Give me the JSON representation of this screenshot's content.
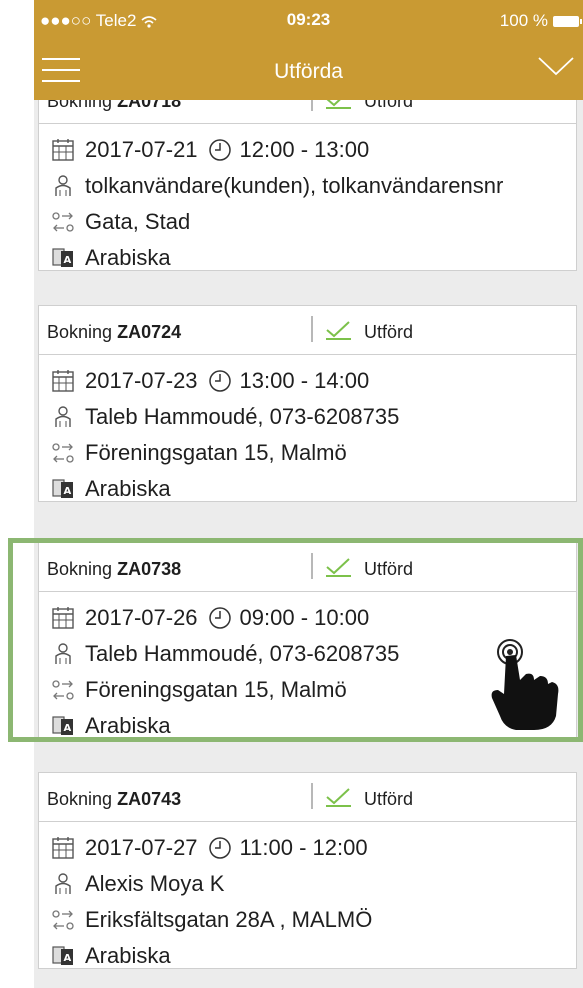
{
  "status_bar": {
    "carrier": "●●●○○ Tele2",
    "wifi_icon": "wifi-icon",
    "time": "09:23",
    "battery": "100 %"
  },
  "nav": {
    "menu_icon": "hamburger-menu-icon",
    "title": "Utförda",
    "dropdown_icon": "chevron-down-icon"
  },
  "accent_color": "#c99a33",
  "highlight_color": "#8cb772",
  "bookings": [
    {
      "prefix": "Bokning",
      "id": "ZA0718",
      "status": "Utförd",
      "date": "2017-07-21",
      "time": "12:00 - 13:00",
      "customer": "tolkanvändare(kunden), tolkanvändarensnr",
      "address": "Gata, Stad",
      "language": "Arabiska"
    },
    {
      "prefix": "Bokning",
      "id": "ZA0724",
      "status": "Utförd",
      "date": "2017-07-23",
      "time": "13:00 - 14:00",
      "customer": "Taleb Hammoudé, 073-6208735",
      "address": "Föreningsgatan 15, Malmö",
      "language": "Arabiska"
    },
    {
      "prefix": "Bokning",
      "id": "ZA0738",
      "status": "Utförd",
      "date": "2017-07-26",
      "time": "09:00 - 10:00",
      "customer": "Taleb Hammoudé, 073-6208735",
      "address": "Föreningsgatan 15, Malmö",
      "language": "Arabiska"
    },
    {
      "prefix": "Bokning",
      "id": "ZA0743",
      "status": "Utförd",
      "date": "2017-07-27",
      "time": "11:00 - 12:00",
      "customer": "Alexis Moya K",
      "address": "Eriksfältsgatan 28A , MALMÖ",
      "language": "Arabiska"
    }
  ]
}
